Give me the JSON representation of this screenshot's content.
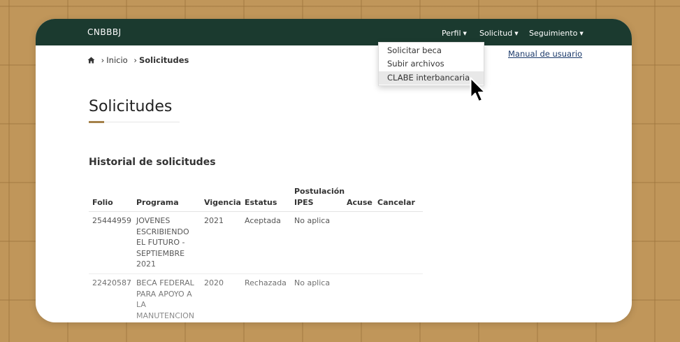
{
  "navbar": {
    "brand": "CNBBBJ",
    "menus": [
      {
        "label": "Perfil"
      },
      {
        "label": "Solicitud"
      },
      {
        "label": "Seguimiento"
      }
    ]
  },
  "dropdown": {
    "items": [
      {
        "label": "Solicitar beca"
      },
      {
        "label": "Subir archivos"
      },
      {
        "label": "CLABE interbancaria"
      }
    ]
  },
  "manual_link": "Manual de usuario",
  "breadcrumb": {
    "home_icon": "home-icon",
    "items": [
      "Inicio",
      "Solicitudes"
    ]
  },
  "page": {
    "title": "Solicitudes",
    "subtitle": "Historial de solicitudes"
  },
  "table": {
    "headers": [
      "Folio",
      "Programa",
      "Vigencia",
      "Estatus",
      "Postulación IPES",
      "Acuse",
      "Cancelar"
    ],
    "rows": [
      {
        "folio": "25444959",
        "programa": "JOVENES ESCRIBIENDO EL FUTURO - SEPTIEMBRE 2021",
        "vigencia": "2021",
        "estatus": "Aceptada",
        "postulacion": "No aplica"
      },
      {
        "folio": "22420587",
        "programa": "BECA FEDERAL PARA APOYO A LA MANUTENCION",
        "vigencia": "2020",
        "estatus": "Rechazada",
        "postulacion": "No aplica"
      }
    ]
  },
  "colors": {
    "navbar_bg": "#1b3a2f",
    "accent": "#a5814a",
    "link": "#1b3a6b"
  }
}
